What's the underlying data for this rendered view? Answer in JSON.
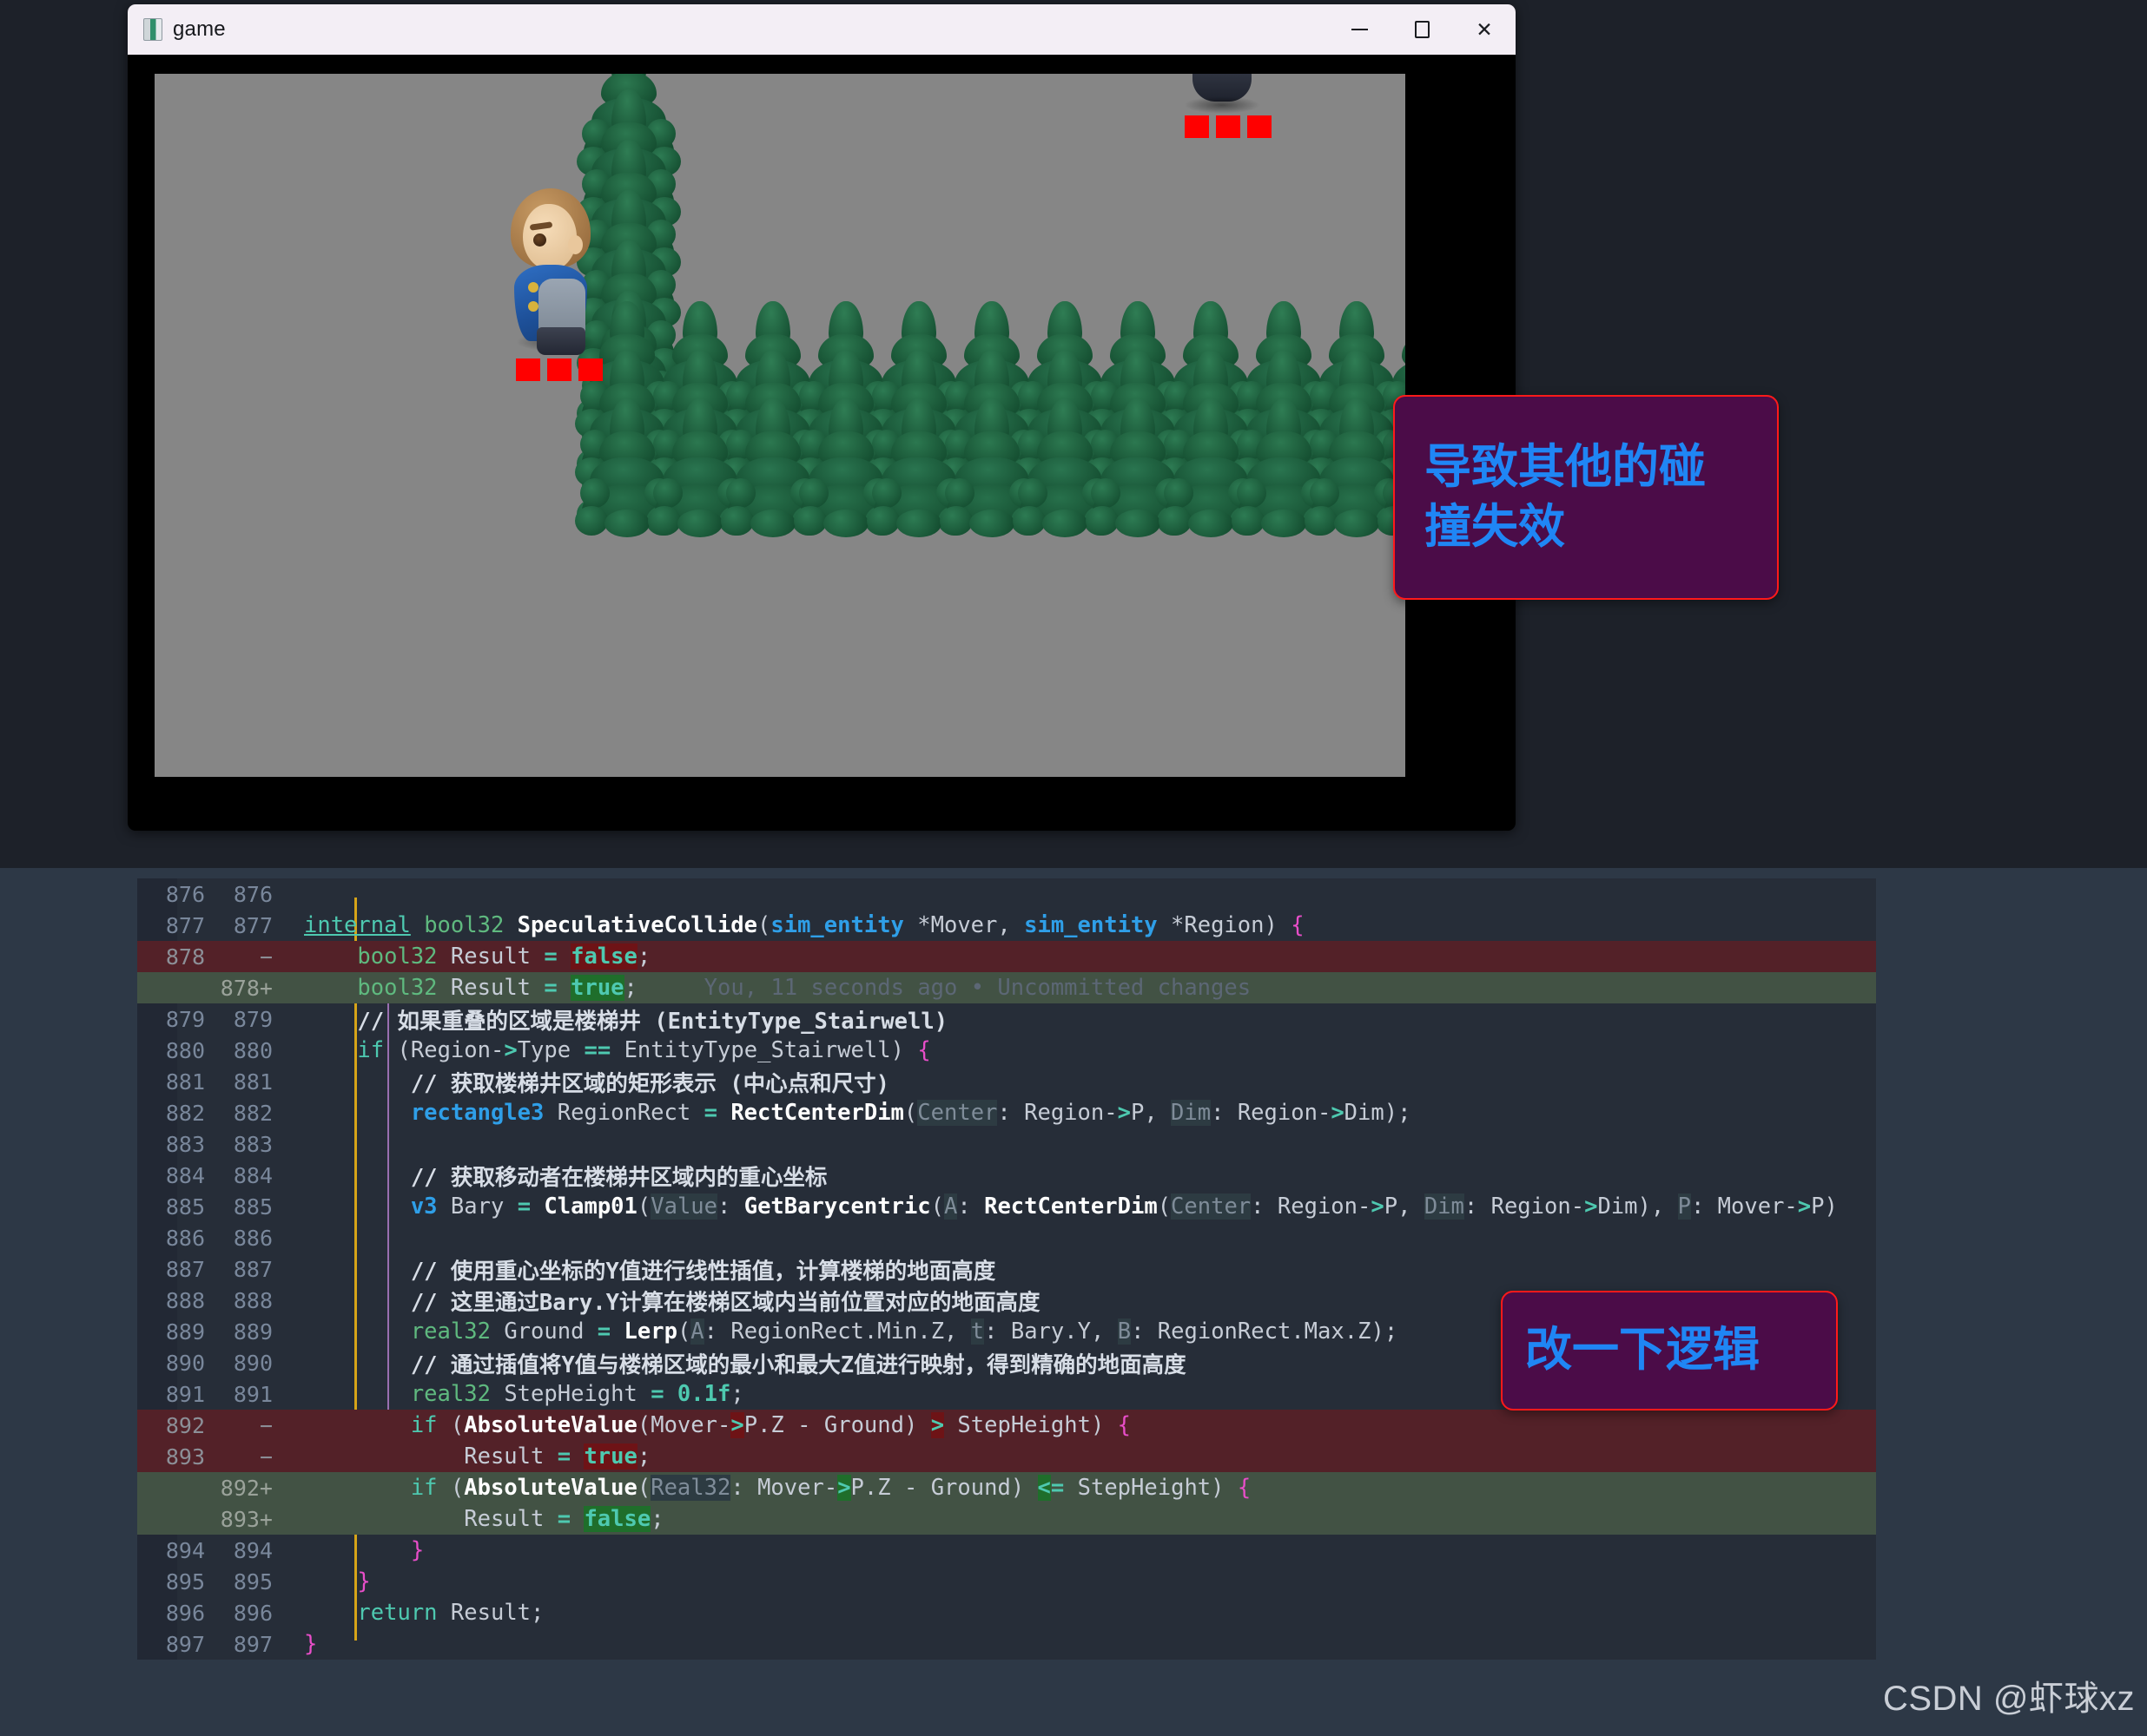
{
  "window": {
    "title": "game",
    "icon": "app-window-icon",
    "minimize_label": "–",
    "maximize_label": "□",
    "close_label": "✕"
  },
  "annotations": [
    {
      "id": "annot-1",
      "text": "导致其他的碰撞失效",
      "bg": "#4b0c48",
      "border": "#ff1a1a",
      "color": "#1f86f5"
    },
    {
      "id": "annot-2",
      "text": "改一下逻辑",
      "bg": "#4b0c48",
      "border": "#ff1a1a",
      "color": "#1f86f5"
    }
  ],
  "gutter": {
    "revert_icon": "↶",
    "stage_icon": "+"
  },
  "blame": "You, 11 seconds ago • Uncommitted changes",
  "diff": {
    "colors": {
      "removed_bg": "#532128",
      "added_bg": "#425244",
      "removed_highlight": "#6e1316",
      "added_highlight": "#1f6e2b",
      "editor_bg": "#262d38",
      "page_bg": "#2d3846"
    },
    "rows": [
      {
        "old": "876",
        "new": "876",
        "kind": "ctx",
        "text": ""
      },
      {
        "old": "877",
        "new": "877",
        "kind": "ctx",
        "text": "internal bool32 SpeculativeCollide(sim_entity *Mover, sim_entity *Region) {"
      },
      {
        "old": "878",
        "new": "−",
        "kind": "del",
        "text": "    bool32 Result = false;"
      },
      {
        "old": "",
        "new": "878+",
        "kind": "add",
        "text": "    bool32 Result = true;"
      },
      {
        "old": "879",
        "new": "879",
        "kind": "ctx",
        "text": "    // 如果重叠的区域是楼梯井 (EntityType_Stairwell)"
      },
      {
        "old": "880",
        "new": "880",
        "kind": "ctx",
        "text": "    if (Region->Type == EntityType_Stairwell) {"
      },
      {
        "old": "881",
        "new": "881",
        "kind": "ctx",
        "text": "        // 获取楼梯井区域的矩形表示 (中心点和尺寸)"
      },
      {
        "old": "882",
        "new": "882",
        "kind": "ctx",
        "text": "        rectangle3 RegionRect = RectCenterDim(Center: Region->P, Dim: Region->Dim);"
      },
      {
        "old": "883",
        "new": "883",
        "kind": "ctx",
        "text": ""
      },
      {
        "old": "884",
        "new": "884",
        "kind": "ctx",
        "text": "        // 获取移动者在楼梯井区域内的重心坐标"
      },
      {
        "old": "885",
        "new": "885",
        "kind": "ctx",
        "text": "        v3 Bary = Clamp01(Value: GetBarycentric(A: RectCenterDim(Center: Region->P, Dim: Region->Dim), P: Mover->P)"
      },
      {
        "old": "886",
        "new": "886",
        "kind": "ctx",
        "text": ""
      },
      {
        "old": "887",
        "new": "887",
        "kind": "ctx",
        "text": "        // 使用重心坐标的Y值进行线性插值，计算楼梯的地面高度"
      },
      {
        "old": "888",
        "new": "888",
        "kind": "ctx",
        "text": "        // 这里通过Bary.Y计算在楼梯区域内当前位置对应的地面高度"
      },
      {
        "old": "889",
        "new": "889",
        "kind": "ctx",
        "text": "        real32 Ground = Lerp(A: RegionRect.Min.Z, t: Bary.Y, B: RegionRect.Max.Z);"
      },
      {
        "old": "890",
        "new": "890",
        "kind": "ctx",
        "text": "        // 通过插值将Y值与楼梯区域的最小和最大Z值进行映射，得到精确的地面高度"
      },
      {
        "old": "891",
        "new": "891",
        "kind": "ctx",
        "text": "        real32 StepHeight = 0.1f;"
      },
      {
        "old": "892",
        "new": "−",
        "kind": "del",
        "text": "        if (AbsoluteValue(Mover->P.Z - Ground) > StepHeight) {"
      },
      {
        "old": "893",
        "new": "−",
        "kind": "del",
        "text": "            Result = true;"
      },
      {
        "old": "",
        "new": "892+",
        "kind": "add",
        "text": "        if (AbsoluteValue(Real32: Mover->P.Z - Ground) <= StepHeight) {"
      },
      {
        "old": "",
        "new": "893+",
        "kind": "add",
        "text": "            Result = false;"
      },
      {
        "old": "894",
        "new": "894",
        "kind": "ctx",
        "text": "        }"
      },
      {
        "old": "895",
        "new": "895",
        "kind": "ctx",
        "text": "    }"
      },
      {
        "old": "896",
        "new": "896",
        "kind": "ctx",
        "text": "    return Result;"
      },
      {
        "old": "897",
        "new": "897",
        "kind": "ctx",
        "text": "}"
      }
    ]
  },
  "watermark": "CSDN @虾球xz",
  "game": {
    "viewport_bg": "#868686",
    "marker_color": "#ff0000",
    "tree_color": "#1d5e3c",
    "character_name": "player-character",
    "far_character_name": "far-character"
  }
}
